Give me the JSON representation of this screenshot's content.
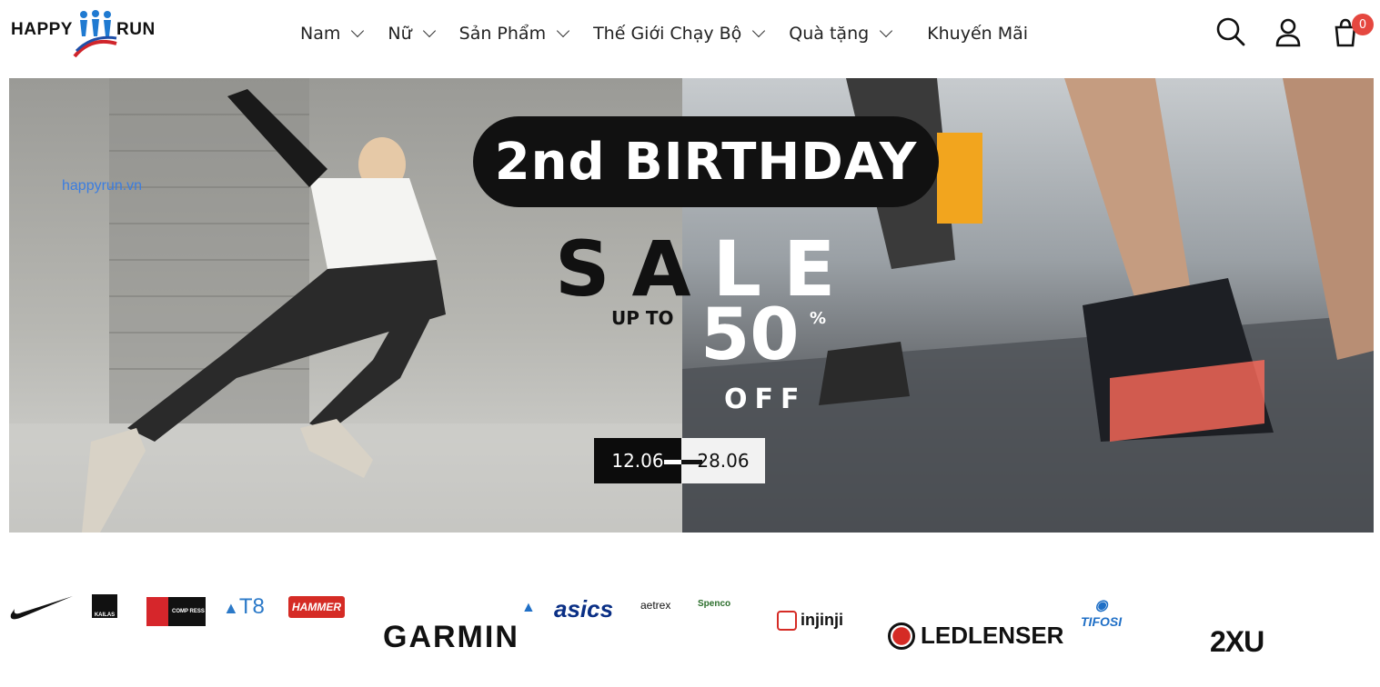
{
  "header": {
    "logo_left": "HAPPY",
    "logo_right": "RUN",
    "nav": [
      {
        "label": "Nam",
        "has_dropdown": true
      },
      {
        "label": "Nữ",
        "has_dropdown": true
      },
      {
        "label": "Sản Phẩm",
        "has_dropdown": true
      },
      {
        "label": "Thế Giới Chạy Bộ",
        "has_dropdown": true
      },
      {
        "label": "Quà tặng",
        "has_dropdown": true
      },
      {
        "label": "Khuyến Mãi",
        "has_dropdown": false
      }
    ],
    "icons": [
      "search-icon",
      "user-icon",
      "cart-icon"
    ],
    "cart_count": "0",
    "badge_color": "#e5473f"
  },
  "banner": {
    "watermark": "happyrun.vn",
    "headline": "2nd BIRTHDAY",
    "sale_dark": "SA",
    "sale_light": "LE",
    "up_to": "UP TO",
    "percent": "50",
    "percent_sign": "%",
    "off": "OFF",
    "date_start": "12.06",
    "date_end": "28.06"
  },
  "brands": {
    "items": [
      {
        "name": "nike",
        "label": ""
      },
      {
        "name": "kailas",
        "label": "KAILAS"
      },
      {
        "name": "compressport",
        "label": "COMP RESS PORT"
      },
      {
        "name": "t8",
        "label": "T8"
      },
      {
        "name": "hammer",
        "label": "HAMMER"
      },
      {
        "name": "garmin",
        "label": "GARMIN"
      },
      {
        "name": "asics",
        "label": "asics"
      },
      {
        "name": "aetrex",
        "label": "aetrex"
      },
      {
        "name": "spenco",
        "label": "Spenco"
      },
      {
        "name": "injinji",
        "label": "injinji"
      },
      {
        "name": "ledlenser",
        "label": "LEDLENSER"
      },
      {
        "name": "tifosi",
        "label": "TIFOSI"
      },
      {
        "name": "2xu",
        "label": "2XU"
      }
    ]
  }
}
